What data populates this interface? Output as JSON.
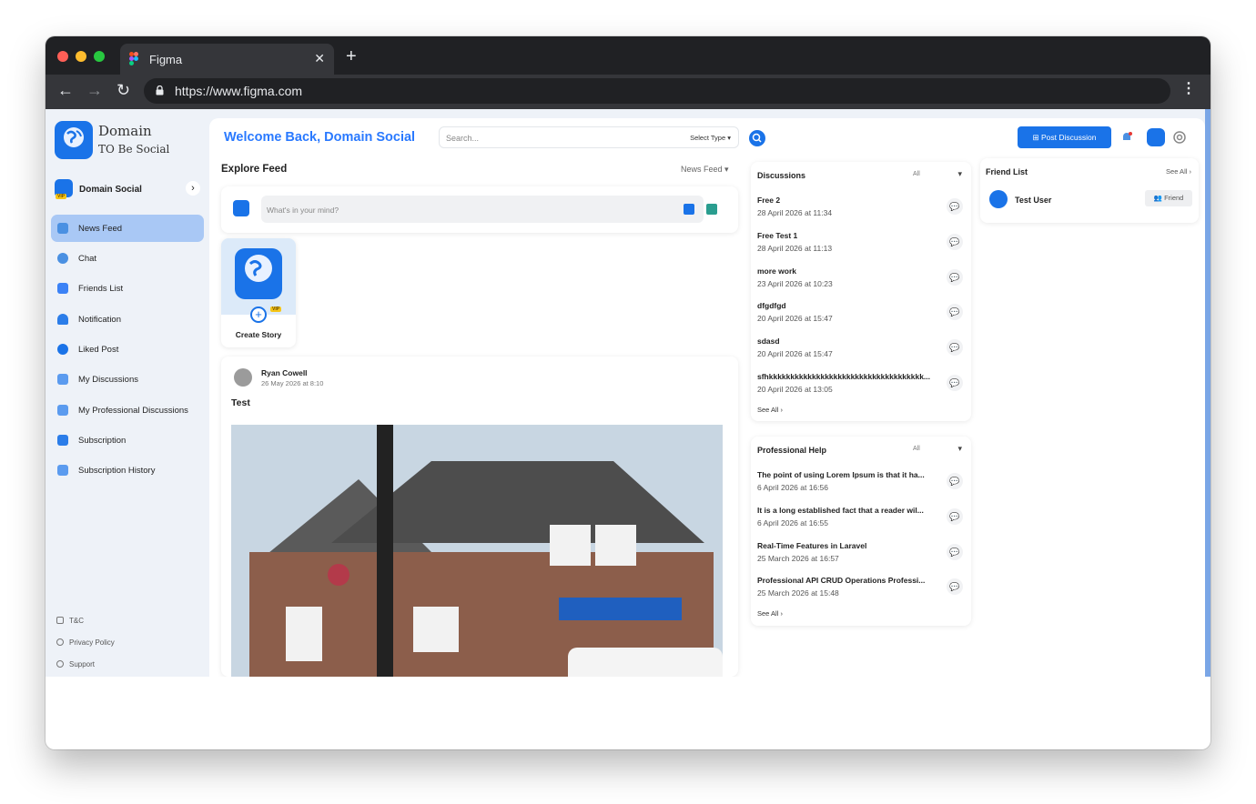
{
  "browser": {
    "tab_title": "Figma",
    "tab_close": "✕",
    "new_tab": "+",
    "url": "https://www.figma.com",
    "back": "←",
    "forward": "→",
    "reload": "↻",
    "menu": "⋮",
    "tab_icon": "figma-icon",
    "lock_icon": "lock-icon"
  },
  "brand": {
    "logo_line1": "Domain",
    "logo_line2": "TO Be Social",
    "logo_mark": "Domain TO Be Social",
    "accent_color": "#1a73e8"
  },
  "sidebar": {
    "profile_name": "Domain Social",
    "profile_badge": "VIP",
    "profile_arrow": "›",
    "items": [
      {
        "label": "News Feed",
        "icon": "news-feed-icon",
        "active": true
      },
      {
        "label": "Chat",
        "icon": "chat-icon"
      },
      {
        "label": "Friends List",
        "icon": "friends-icon"
      },
      {
        "label": "Notification",
        "icon": "bell-icon"
      },
      {
        "label": "Liked Post",
        "icon": "thumbs-up-icon"
      },
      {
        "label": "My Discussions",
        "icon": "discussion-icon"
      },
      {
        "label": "My Professional Discussions",
        "icon": "discussion-icon"
      },
      {
        "label": "Subscription",
        "icon": "lock-icon"
      },
      {
        "label": "Subscription History",
        "icon": "history-icon"
      }
    ],
    "footer": [
      {
        "label": "T&C",
        "icon": "document-icon"
      },
      {
        "label": "Privacy Policy",
        "icon": "shield-icon"
      },
      {
        "label": "Support",
        "icon": "headset-icon"
      }
    ]
  },
  "header": {
    "welcome_prefix": "Welcome Back, ",
    "welcome_name": "Domain Social",
    "search_placeholder": "Search...",
    "select_type": "Select Type",
    "post_discussion": "Post Discussion"
  },
  "feed": {
    "title": "Explore Feed",
    "selector": "News Feed",
    "composer_placeholder": "What's in your mind?",
    "story_label": "Create Story",
    "story_badge": "VIP",
    "post": {
      "author": "Ryan Cowell",
      "time": "26 May 2026 at 8:10",
      "text": "Test"
    }
  },
  "discussions": {
    "title": "Discussions",
    "filter": "All",
    "items": [
      {
        "title": "Free 2",
        "time": "28 April 2026 at 11:34"
      },
      {
        "title": "Free Test 1",
        "time": "28 April 2026 at 11:13"
      },
      {
        "title": "more work",
        "time": "23 April 2026 at 10:23"
      },
      {
        "title": "dfgdfgd",
        "time": "20 April 2026 at 15:47"
      },
      {
        "title": "sdasd",
        "time": "20 April 2026 at 15:47"
      },
      {
        "title": "sfhkkkkkkkkkkkkkkkkkkkkkkkkkkkkkkkkkkkk...",
        "time": "20 April 2026 at 13:05"
      }
    ],
    "see_all": "See All"
  },
  "professional_help": {
    "title": "Professional Help",
    "filter": "All",
    "items": [
      {
        "title": "The point of using Lorem Ipsum is that it ha...",
        "time": "6 April 2026 at 16:56"
      },
      {
        "title": "It is a long established fact that a reader wil...",
        "time": "6 April 2026 at 16:55"
      },
      {
        "title": "Real-Time Features in Laravel",
        "time": "25 March 2026 at 16:57"
      },
      {
        "title": "Professional API CRUD Operations Professi...",
        "time": "25 March 2026 at 15:48"
      }
    ],
    "see_all": "See All"
  },
  "friends": {
    "title": "Friend List",
    "see_all": "See All",
    "items": [
      {
        "name": "Test User",
        "button": "Friend"
      }
    ]
  }
}
